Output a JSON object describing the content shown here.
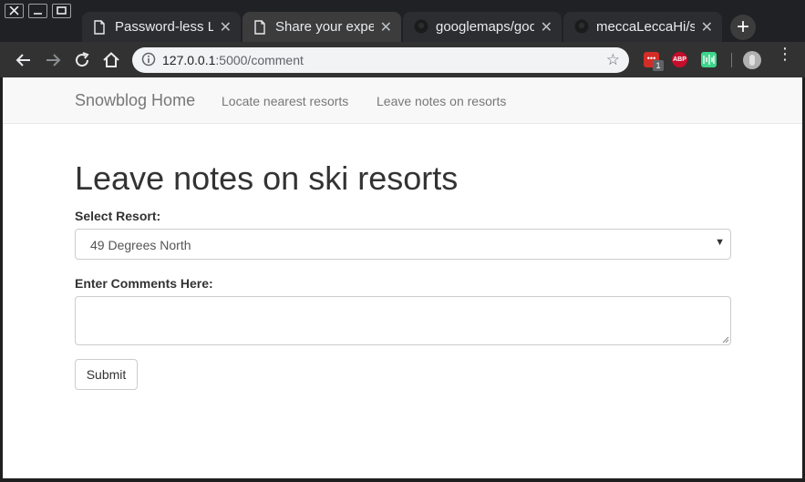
{
  "browser": {
    "tabs": [
      {
        "title": "Password-less Lo",
        "active": false,
        "icon": "document-icon"
      },
      {
        "title": "Share your exper",
        "active": true,
        "icon": "document-icon"
      },
      {
        "title": "googlemaps/goo",
        "active": false,
        "icon": "github-icon"
      },
      {
        "title": "meccaLeccaHi/s",
        "active": false,
        "icon": "github-icon"
      }
    ],
    "new_tab_label": "+",
    "url_host": "127.0.0.1",
    "url_path": ":5000/comment",
    "extension_badge": "1",
    "extensions": [
      {
        "name": "lastpass-icon",
        "label": "•••",
        "color": "#d32d27"
      },
      {
        "name": "adblock-icon",
        "label": "ABP",
        "color": "#c70d2c"
      },
      {
        "name": "green-extension-icon",
        "label": "",
        "color": "#3dd68c"
      }
    ],
    "tab_close": "✕",
    "menu_glyph": "⋮"
  },
  "navbar": {
    "brand": "Snowblog Home",
    "links": [
      "Locate nearest resorts",
      "Leave notes on resorts"
    ]
  },
  "main": {
    "heading": "Leave notes on ski resorts",
    "select_label": "Select Resort:",
    "select_value": "49 Degrees North",
    "comments_label": "Enter Comments Here:",
    "comments_value": "",
    "submit_label": "Submit"
  }
}
